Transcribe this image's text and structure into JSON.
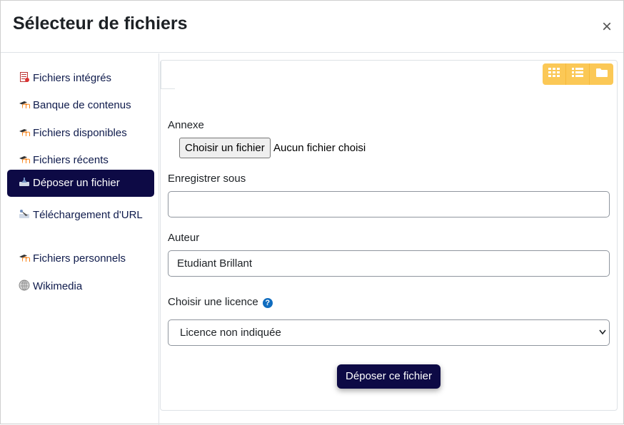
{
  "modal": {
    "title": "Sélecteur de fichiers",
    "close_symbol": "×"
  },
  "sidebar": {
    "items": [
      {
        "label": "Fichiers intégrés",
        "icon": "embedded-files-icon",
        "active": false
      },
      {
        "label": "Banque de contenus",
        "icon": "moodle-icon",
        "active": false
      },
      {
        "label": "Fichiers disponibles",
        "icon": "moodle-icon",
        "active": false
      },
      {
        "label": "Fichiers récents",
        "icon": "moodle-icon",
        "active": false
      },
      {
        "label": "Déposer un fichier",
        "icon": "upload-icon",
        "active": true
      },
      {
        "label": "Téléchargement d'URL",
        "icon": "url-download-icon",
        "active": false
      },
      {
        "label": "Fichiers personnels",
        "icon": "moodle-icon",
        "active": false
      },
      {
        "label": "Wikimedia",
        "icon": "wikimedia-icon",
        "active": false
      }
    ]
  },
  "toolbar": {
    "buttons": [
      "grid-view-icon",
      "list-view-icon",
      "folder-view-icon"
    ],
    "color": "#fbc856"
  },
  "form": {
    "attachment_label": "Annexe",
    "file_button_label": "Choisir un fichier",
    "file_status": "Aucun fichier choisi",
    "save_as_label": "Enregistrer sous",
    "save_as_value": "",
    "author_label": "Auteur",
    "author_value": "Etudiant Brillant",
    "license_label": "Choisir une licence",
    "license_selected": "Licence non indiquée",
    "submit_label": "Déposer ce fichier"
  },
  "colors": {
    "primary": "#0d0a45",
    "accent": "#fbc856",
    "help": "#0f6cbf"
  }
}
